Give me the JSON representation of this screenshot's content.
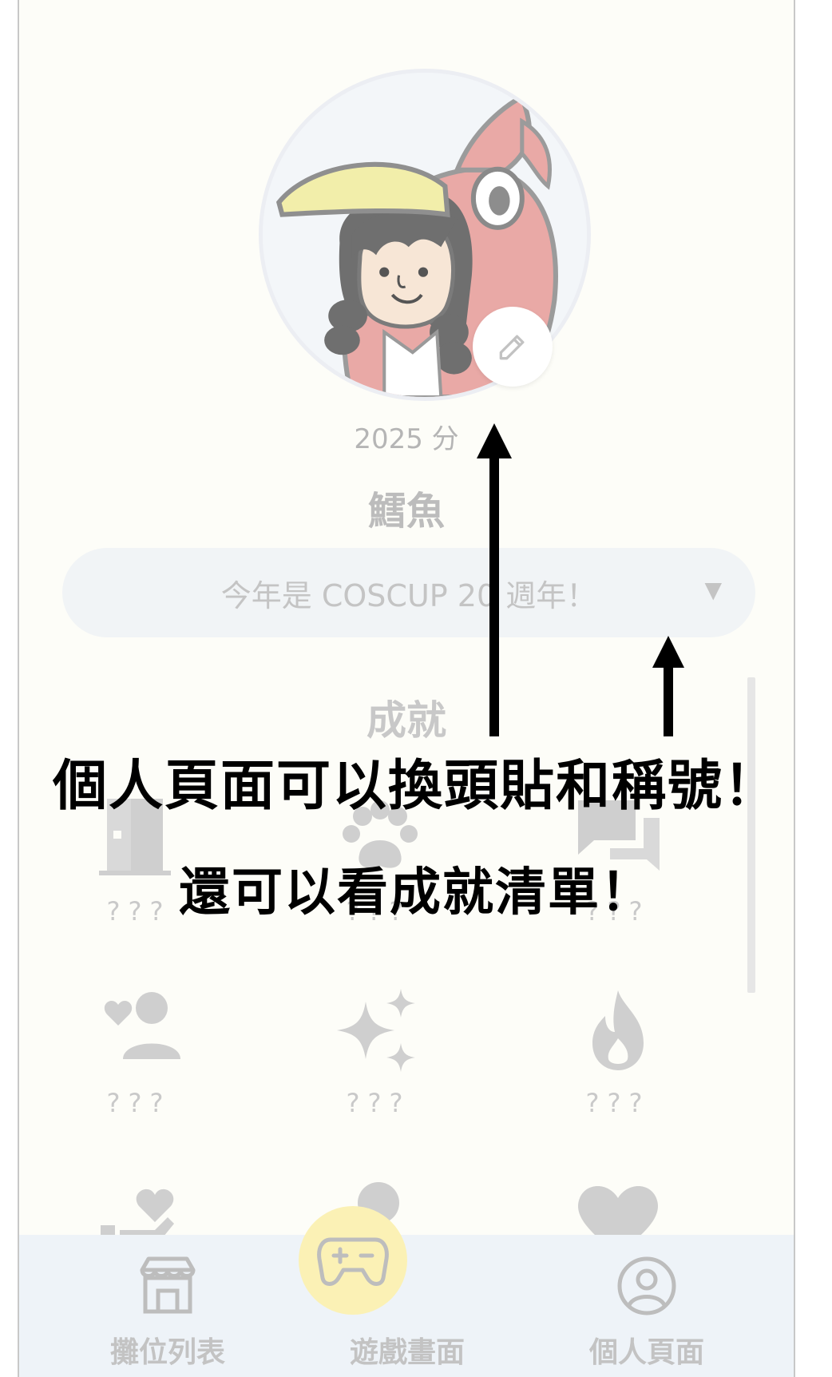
{
  "profile": {
    "score_text": "2025 分",
    "nickname": "鱈魚",
    "title_selected": "今年是 COSCUP 20 週年！",
    "title_caret": "▼"
  },
  "achievements": {
    "heading": "成就",
    "items": [
      {
        "icon": "door-icon",
        "label": "???"
      },
      {
        "icon": "paw-icon",
        "label": "???"
      },
      {
        "icon": "chat-icon",
        "label": "???"
      },
      {
        "icon": "heart-person-icon",
        "label": "???"
      },
      {
        "icon": "sparkles-icon",
        "label": "???"
      },
      {
        "icon": "fire-icon",
        "label": "???"
      },
      {
        "icon": "hand-heart-icon",
        "label": ""
      },
      {
        "icon": "person-icon",
        "label": ""
      },
      {
        "icon": "heart-icon",
        "label": ""
      }
    ]
  },
  "nav": {
    "booths_label": "攤位列表",
    "game_label": "遊戲畫面",
    "profile_label": "個人頁面"
  },
  "annotation": {
    "line1": "個人頁面可以換頭貼和稱號！",
    "line2": "還可以看成就清單！"
  },
  "colors": {
    "background": "#fdfdf8",
    "nav_background": "#eef3f8",
    "game_button": "#fbf1b5",
    "muted_text": "#c3c3c3"
  }
}
